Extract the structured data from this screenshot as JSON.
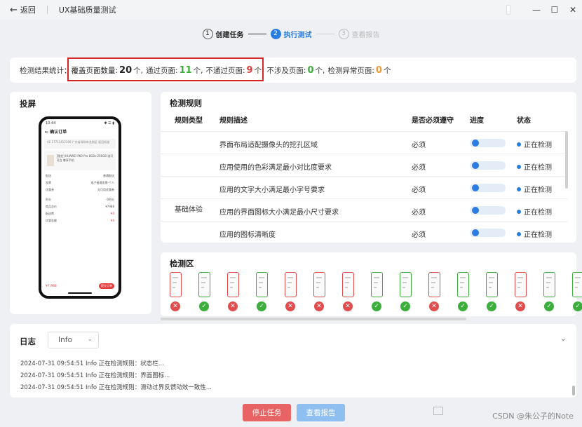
{
  "titlebar": {
    "back_label": "返回",
    "title": "UX基础质量测试"
  },
  "stepper": {
    "steps": [
      {
        "num": "1",
        "label": "创建任务"
      },
      {
        "num": "2",
        "label": "执行测试"
      },
      {
        "num": "3",
        "label": "查看报告"
      }
    ]
  },
  "summary": {
    "prefix": "检测结果统计：",
    "covered_label": "覆盖页面数量:",
    "covered_value": "20",
    "pass_label": "通过页面:",
    "pass_value": "11",
    "fail_label": "不通过页面:",
    "fail_value": "9",
    "na_label": "不涉及页面:",
    "na_value": "0",
    "err_label": "检测异常页面:",
    "err_value": "0",
    "unit": "个,",
    "unit_last": "个"
  },
  "projection": {
    "title": "投屏",
    "phone": {
      "time": "10:44",
      "icons": "✱ ☰ ▮",
      "header": "← 确认订单",
      "address": "AE 17711412306 广东省深圳市龙岗区 坂田街道",
      "item_text": "[限定] HUAWEI P60 Pro 8GB+256GB 洛可可白 尊享手机",
      "item_price": "¥7,988",
      "rows": [
        {
          "l": "配送",
          "r": "普通配送"
        },
        {
          "l": "发票",
          "r": "电子普通发票-个人"
        },
        {
          "l": "优惠券",
          "r": "无可用优惠券"
        },
        {
          "l": "积分",
          "r": "-0积分"
        },
        {
          "l": "商品总价",
          "r": "¥7988"
        },
        {
          "l": "配送费",
          "r": "¥0"
        },
        {
          "l": "优惠金额",
          "r": "¥0"
        }
      ],
      "total": "¥7,988",
      "pay": "提交订单"
    }
  },
  "rules": {
    "title": "检测规则",
    "columns": [
      "规则类型",
      "规则描述",
      "是否必须遵守",
      "进度",
      "状态"
    ],
    "group": "基础体验",
    "rows": [
      {
        "desc": "界面布局适配摄像头的挖孔区域",
        "required": "必须",
        "progress": 0.05,
        "status": "正在检测"
      },
      {
        "desc": "应用使用的色彩满足最小对比度要求",
        "required": "必须",
        "progress": 0.05,
        "status": "正在检测"
      },
      {
        "desc": "应用的文字大小满足最小字号要求",
        "required": "必须",
        "progress": 0.05,
        "status": "正在检测"
      },
      {
        "desc": "应用的界面图标大小满足最小尺寸要求",
        "required": "必须",
        "progress": 0.05,
        "status": "正在检测"
      },
      {
        "desc": "应用的图标清晰度",
        "required": "必须",
        "progress": 0.05,
        "status": "正在检测"
      }
    ]
  },
  "detect": {
    "title": "检测区",
    "results": [
      "fail",
      "pass",
      "fail",
      "pass",
      "fail",
      "fail",
      "fail",
      "pass",
      "pass",
      "fail",
      "pass",
      "pass",
      "fail",
      "pass",
      "pass"
    ],
    "colors": {
      "pass": "#3cae3c",
      "fail": "#e14c4c"
    }
  },
  "logs": {
    "title": "日志",
    "level": "Info",
    "lines": [
      "2024-07-31 09:54:51 Info 正在检测规则：状态栏...",
      "2024-07-31 09:54:51 Info 正在检测规则：界面图标...",
      "2024-07-31 09:54:51 Info 正在检测规则：滑动过界反馈动效一致性..."
    ]
  },
  "actions": {
    "stop": "停止任务",
    "report": "查看报告"
  },
  "watermark": "CSDN @朱公子的Note"
}
